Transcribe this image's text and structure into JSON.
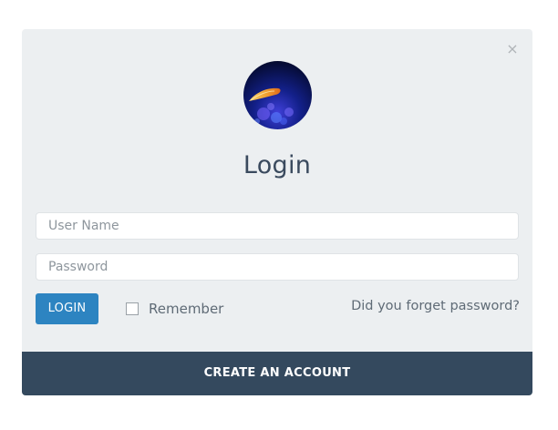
{
  "modal": {
    "title": "Login",
    "close_glyph": "×",
    "avatar_icon": "avatar-image"
  },
  "form": {
    "username": {
      "value": "",
      "placeholder": "User Name"
    },
    "password": {
      "value": "",
      "placeholder": "Password"
    },
    "login_label": "LOGIN",
    "remember_label": "Remember",
    "remember_checked": false,
    "forgot_label": "Did you forget password?"
  },
  "footer": {
    "create_label": "CREATE AN ACCOUNT"
  },
  "colors": {
    "modal_bg": "#eceff1",
    "primary": "#2d84c1",
    "footer_bg": "#34495e",
    "title": "#3a4a5e"
  }
}
